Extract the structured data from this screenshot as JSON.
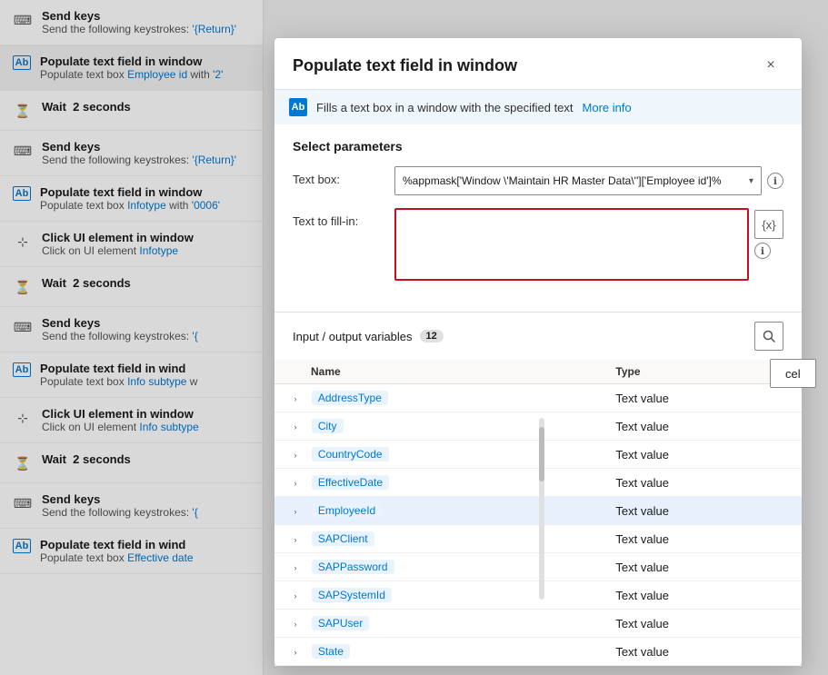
{
  "leftPanel": {
    "steps": [
      {
        "id": "send-keys-1",
        "icon": "keyboard",
        "title": "Send keys",
        "desc": "Send the following keystrokes: '{Return}'"
      },
      {
        "id": "populate-text-1",
        "icon": "textbox",
        "title": "Populate text field in window",
        "desc": "Populate text box Employee id with '2'",
        "highlighted": true
      },
      {
        "id": "wait-1",
        "icon": "hourglass",
        "title": "Wait  2 seconds",
        "desc": ""
      },
      {
        "id": "send-keys-2",
        "icon": "keyboard",
        "title": "Send keys",
        "desc": "Send the following keystrokes: '{Return}'"
      },
      {
        "id": "populate-text-2",
        "icon": "textbox",
        "title": "Populate text field in window",
        "desc": "Populate text box Infotype with '0006'",
        "highlightWord": "Infotype"
      },
      {
        "id": "click-ui-1",
        "icon": "click",
        "title": "Click UI element in window",
        "desc": "Click on UI element Infotype",
        "highlightWord": "Infotype"
      },
      {
        "id": "wait-2",
        "icon": "hourglass",
        "title": "Wait  2 seconds",
        "desc": ""
      },
      {
        "id": "send-keys-3",
        "icon": "keyboard",
        "title": "Send keys",
        "desc": "Send the following keystrokes: '{'"
      },
      {
        "id": "populate-text-3",
        "icon": "textbox",
        "title": "Populate text field in wind",
        "desc": "Populate text box Info subtype w"
      },
      {
        "id": "click-ui-2",
        "icon": "click",
        "title": "Click UI element in window",
        "desc": "Click on UI element Info subtype"
      },
      {
        "id": "wait-3",
        "icon": "hourglass",
        "title": "Wait  2 seconds",
        "desc": ""
      },
      {
        "id": "send-keys-4",
        "icon": "keyboard",
        "title": "Send keys",
        "desc": "Send the following keystrokes: '{'"
      },
      {
        "id": "populate-text-4",
        "icon": "textbox",
        "title": "Populate text field in wind",
        "desc": "Populate text box Effective date"
      }
    ]
  },
  "modal": {
    "title": "Populate text field in window",
    "closeLabel": "×",
    "infoText": "Fills a text box in a window with the specified text",
    "moreInfoLabel": "More info",
    "sectionTitle": "Select parameters",
    "textBoxLabel": "Text box:",
    "textBoxValue": "%appmask['Window \\'Maintain HR Master Data\\'']['Employee id']%",
    "textToFillLabel": "Text to fill-in:",
    "textToFillValue": "",
    "varIconLabel": "{x}",
    "inputOutputLabel": "Input / output variables",
    "varCount": "12",
    "cancelLabel": "cel",
    "table": {
      "columns": [
        "Name",
        "Type"
      ],
      "rows": [
        {
          "name": "AddressType",
          "type": "Text value",
          "selected": false
        },
        {
          "name": "City",
          "type": "Text value",
          "selected": false
        },
        {
          "name": "CountryCode",
          "type": "Text value",
          "selected": false
        },
        {
          "name": "EffectiveDate",
          "type": "Text value",
          "selected": false
        },
        {
          "name": "EmployeeId",
          "type": "Text value",
          "selected": true
        },
        {
          "name": "SAPClient",
          "type": "Text value",
          "selected": false
        },
        {
          "name": "SAPPassword",
          "type": "Text value",
          "selected": false
        },
        {
          "name": "SAPSystemId",
          "type": "Text value",
          "selected": false
        },
        {
          "name": "SAPUser",
          "type": "Text value",
          "selected": false
        },
        {
          "name": "State",
          "type": "Text value",
          "selected": false
        }
      ]
    }
  }
}
